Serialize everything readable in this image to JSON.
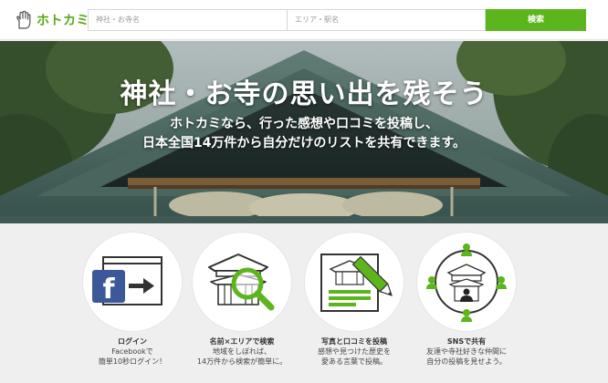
{
  "header": {
    "logo_text": "ホトカミ",
    "search_shrine_placeholder": "神社・お寺名",
    "search_area_placeholder": "エリア・駅名",
    "search_button": "検索"
  },
  "hero": {
    "title": "神社・お寺の思い出を残そう",
    "subtitle_line1": "ホトカミなら、行った感想や口コミを投稿し、",
    "subtitle_line2": "日本全国14万件から自分だけのリストを共有できます。"
  },
  "features": [
    {
      "icon": "facebook-login-icon",
      "title": "ログイン",
      "desc1": "Facebookで",
      "desc2": "簡単10秒ログイン！"
    },
    {
      "icon": "temple-search-icon",
      "title": "名前×エリアで検索",
      "desc1": "地域をしぼれば、",
      "desc2": "14万件から検索が簡単に。"
    },
    {
      "icon": "photo-post-icon",
      "title": "写真と口コミを投稿",
      "desc1": "感想や見つけた歴史を",
      "desc2": "愛ある言葉で投稿。"
    },
    {
      "icon": "sns-share-icon",
      "title": "SNSで共有",
      "desc1": "友達や寺社好きな仲間に",
      "desc2": "自分の投稿を見せよう。"
    }
  ],
  "colors": {
    "brand_green": "#5cb51d",
    "facebook_blue": "#3b5998",
    "header_bg": "#ffffff",
    "features_bg": "#efefef"
  }
}
